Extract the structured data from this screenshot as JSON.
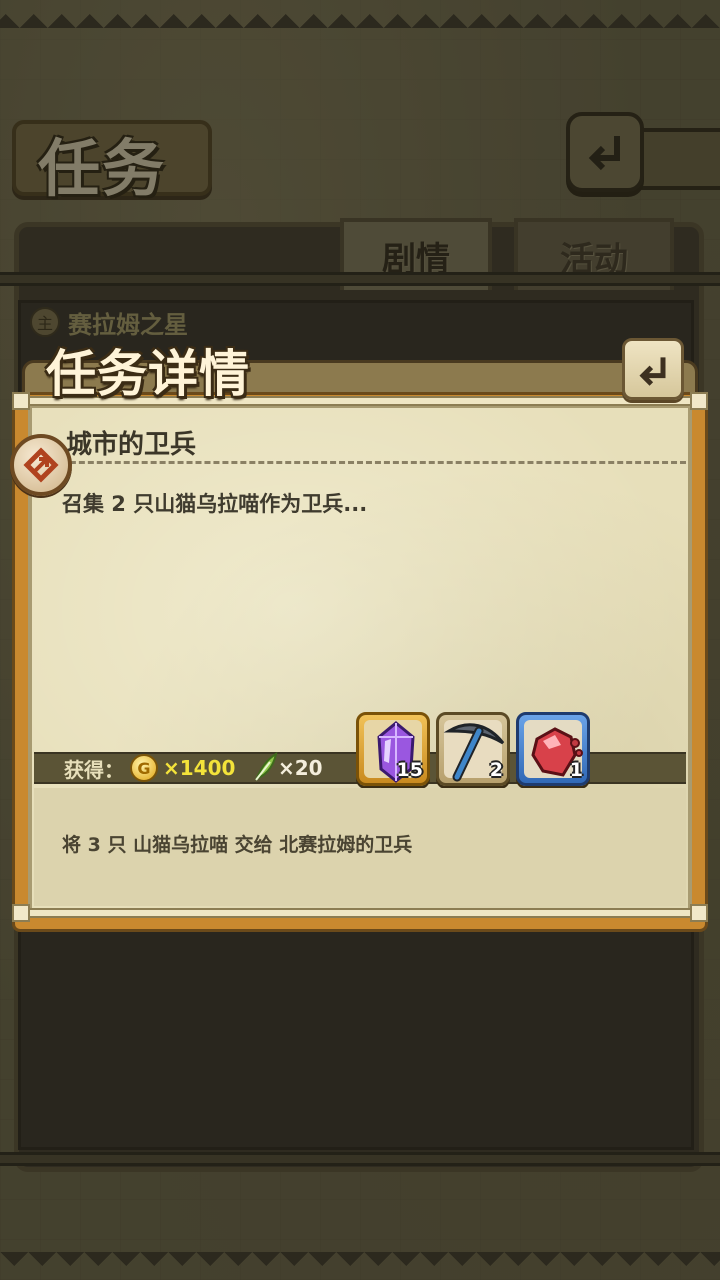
{
  "header": {
    "title": "任务",
    "back_icon": "back-arrow-icon"
  },
  "tabs": [
    {
      "label": "剧情",
      "active": true
    },
    {
      "label": "活动",
      "active": false
    }
  ],
  "list": {
    "items": [
      {
        "badge": "主",
        "name": "赛拉姆之星"
      }
    ]
  },
  "dialog": {
    "title": "任务详情",
    "back_icon": "back-arrow-icon",
    "quest": {
      "name": "城市的卫兵",
      "icon": "quest-marker-icon",
      "description": "召集 2 只山猫乌拉喵作为卫兵..."
    },
    "rewards": {
      "label": "获得：",
      "coin_symbol": "G",
      "coin_value": "×1400",
      "feather_value": "×20",
      "items": [
        {
          "icon": "purple-crystal-icon",
          "count": "15",
          "frame": "gold"
        },
        {
          "icon": "pickaxe-icon",
          "count": "2",
          "frame": "plain"
        },
        {
          "icon": "red-ore-icon",
          "count": "1",
          "frame": "blue"
        }
      ]
    },
    "objective": "将 3 只 山猫乌拉喵 交给 北赛拉姆的卫兵"
  },
  "colors": {
    "coin_text": "#f3e33a",
    "dialog_frame": "#c9892f",
    "paper": "#e7dfba"
  }
}
